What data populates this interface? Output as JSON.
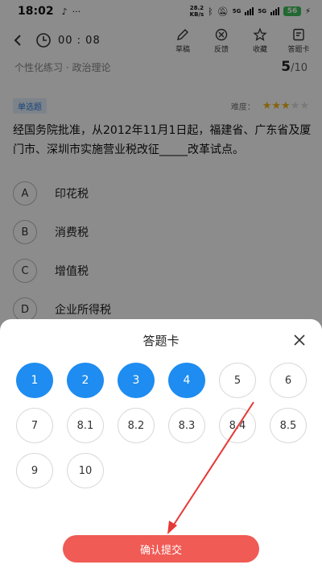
{
  "status_bar": {
    "time": "18:02",
    "left_icons": [
      "tiktok-icon",
      "more-dots-icon"
    ],
    "net_speed_value": "28.2",
    "net_speed_unit": "KB/s",
    "battery": "56",
    "sim1": "5G",
    "sim2": "5G"
  },
  "header": {
    "timer": "00 : 08",
    "actions": [
      {
        "icon": "pen-icon",
        "label": "草稿"
      },
      {
        "icon": "feedback-icon",
        "label": "反馈"
      },
      {
        "icon": "star-outline-icon",
        "label": "收藏"
      },
      {
        "icon": "answer-card-icon",
        "label": "答题卡"
      }
    ]
  },
  "breadcrumb": {
    "text": "个性化练习 · 政治理论",
    "current": "5",
    "total": "/10"
  },
  "question": {
    "type": "单选题",
    "difficulty_label": "难度：",
    "difficulty_stars": 3,
    "difficulty_max": 5,
    "text": "经国务院批准，从2012年11月1日起，福建省、广东省及厦门市、深圳市实施营业税改征_____改革试点。",
    "options": [
      {
        "letter": "A",
        "text": "印花税"
      },
      {
        "letter": "B",
        "text": "消费税"
      },
      {
        "letter": "C",
        "text": "增值税"
      },
      {
        "letter": "D",
        "text": "企业所得税"
      }
    ]
  },
  "answer_sheet": {
    "title": "答题卡",
    "items": [
      {
        "label": "1",
        "answered": true
      },
      {
        "label": "2",
        "answered": true
      },
      {
        "label": "3",
        "answered": true
      },
      {
        "label": "4",
        "answered": true
      },
      {
        "label": "5",
        "answered": false
      },
      {
        "label": "6",
        "answered": false
      },
      {
        "label": "7",
        "answered": false
      },
      {
        "label": "8.1",
        "answered": false
      },
      {
        "label": "8.2",
        "answered": false
      },
      {
        "label": "8.3",
        "answered": false
      },
      {
        "label": "8.4",
        "answered": false
      },
      {
        "label": "8.5",
        "answered": false
      },
      {
        "label": "9",
        "answered": false
      },
      {
        "label": "10",
        "answered": false
      }
    ],
    "submit_label": "确认提交"
  },
  "colors": {
    "accent_blue": "#1e8cf0",
    "submit_red": "#f05b55",
    "star_gold": "#f3b415",
    "annotation_arrow": "#e53935"
  }
}
